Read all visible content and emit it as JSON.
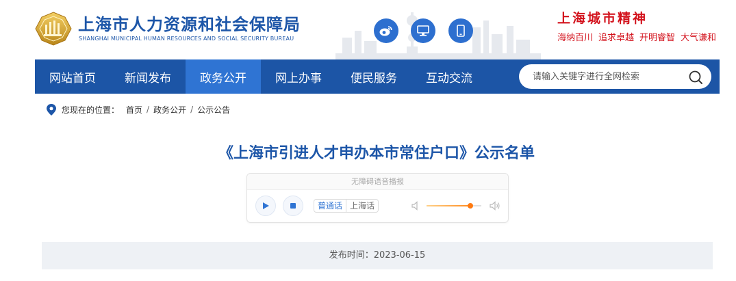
{
  "header": {
    "title": "上海市人力资源和社会保障局",
    "subtitle": "SHANGHAI MUNICIPAL HUMAN RESOURCES AND SOCIAL SECURITY BUREAU",
    "icons": [
      "weibo-icon",
      "desktop-icon",
      "mobile-icon"
    ],
    "slogan_title": "上海城市精神",
    "slogan_items": [
      "海纳百川",
      "追求卓越",
      "开明睿智",
      "大气谦和"
    ]
  },
  "nav": {
    "items": [
      {
        "label": "网站首页",
        "active": false
      },
      {
        "label": "新闻发布",
        "active": false
      },
      {
        "label": "政务公开",
        "active": true
      },
      {
        "label": "网上办事",
        "active": false
      },
      {
        "label": "便民服务",
        "active": false
      },
      {
        "label": "互动交流",
        "active": false
      }
    ],
    "search_placeholder": "请输入关键字进行全网检索"
  },
  "breadcrumb": {
    "label": "您现在的位置：",
    "items": [
      "首页",
      "政务公开",
      "公示公告"
    ],
    "separator": "/"
  },
  "article": {
    "title": "《上海市引进人才申办本市常住户口》公示名单",
    "publish_label": "发布时间：",
    "publish_date": "2023-06-15"
  },
  "player": {
    "header": "无障碍语音播报",
    "lang_options": [
      "普通话",
      "上海话"
    ],
    "selected_lang": "普通话",
    "volume": 0.8
  },
  "colors": {
    "brand_blue": "#1c55a6",
    "nav_active": "#2f74d3",
    "slogan_red": "#d3121c",
    "volume_orange": "#ff7a10"
  }
}
